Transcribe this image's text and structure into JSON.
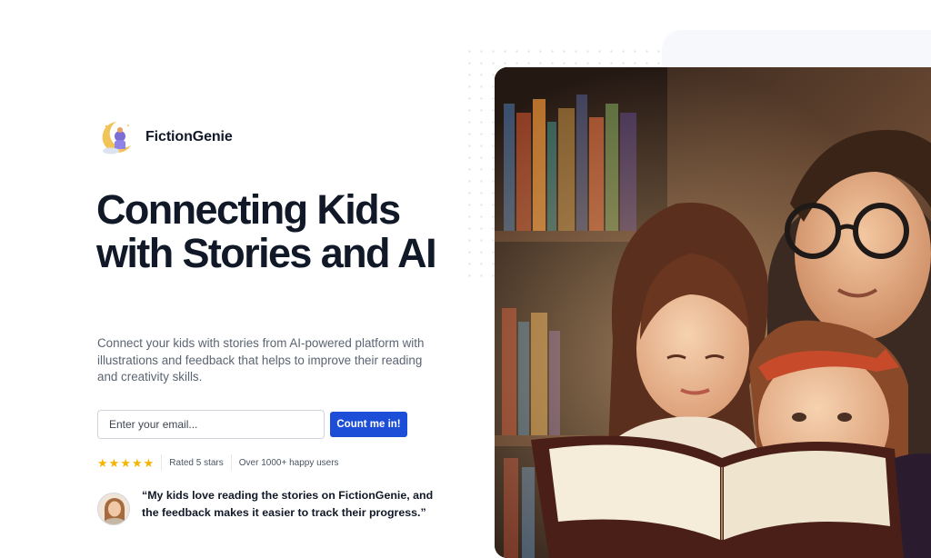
{
  "brand": {
    "name": "FictionGenie",
    "logo_icon": "genie-moon-logo-icon"
  },
  "hero": {
    "headline": "Connecting Kids with Stories and AI",
    "description": "Connect your kids with stories from AI-powered platform with illustrations and feedback that helps to improve their reading and creativity skills.",
    "image": "family-reading-illustration"
  },
  "signup": {
    "email_placeholder": "Enter your email...",
    "email_value": "",
    "cta_label": "Count me in!"
  },
  "rating": {
    "stars": 5,
    "stars_glyph": "★",
    "rated_label": "Rated 5 stars",
    "users_label": "Over 1000+ happy users"
  },
  "testimonial": {
    "quote": "“My kids love reading the stories on FictionGenie, and the feedback makes it easier to track their progress.”",
    "avatar": "parent-avatar"
  },
  "colors": {
    "primary": "#1d4ed8",
    "star": "#f5b400",
    "heading": "#111827",
    "body_text": "#5b6472"
  }
}
